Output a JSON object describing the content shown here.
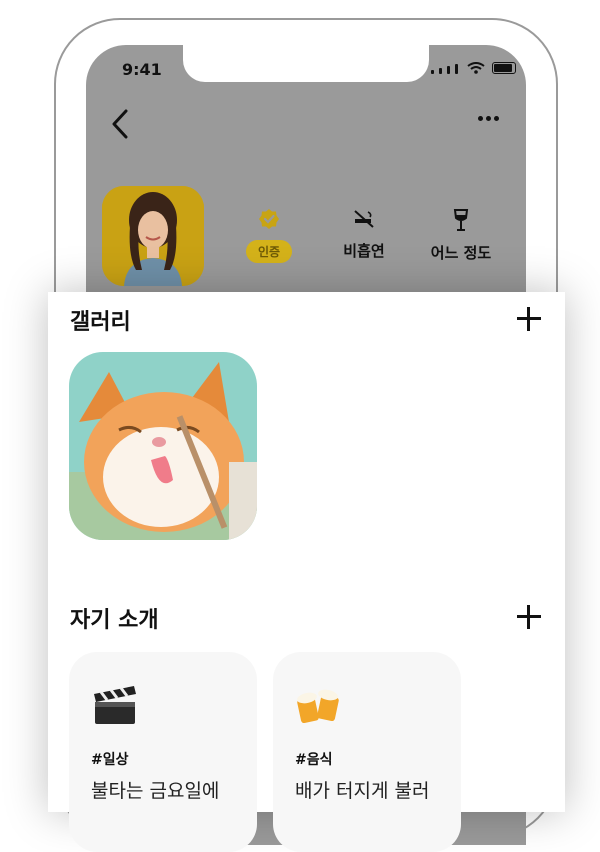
{
  "status_bar": {
    "time": "9:41"
  },
  "header": {
    "back_icon": "chevron-left-icon",
    "more_icon": "more-horizontal-icon"
  },
  "profile": {
    "badges": [
      {
        "icon": "verified-check-icon",
        "label": "인증"
      },
      {
        "icon": "no-smoking-icon",
        "label": "비흡연"
      },
      {
        "icon": "wine-glass-icon",
        "label": "어느 정도"
      }
    ]
  },
  "gallery": {
    "title": "갤러리",
    "add_icon": "plus-icon"
  },
  "intro": {
    "title": "자기 소개",
    "add_icon": "plus-icon",
    "cards": [
      {
        "icon": "clapperboard-icon",
        "tag": "#일상",
        "text": "불타는 금요일에"
      },
      {
        "icon": "beer-mugs-icon",
        "tag": "#음식",
        "text": "배가 터지게 불러"
      }
    ]
  },
  "colors": {
    "accent": "#d4b21a",
    "overlay": "#9a9a9a"
  }
}
